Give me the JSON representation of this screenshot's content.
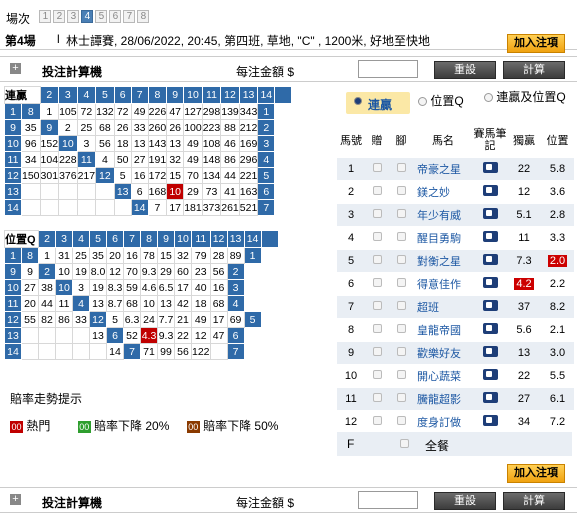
{
  "header": {
    "race_label": "場次",
    "races": [
      "1",
      "2",
      "3",
      "4",
      "5",
      "6",
      "7",
      "8"
    ],
    "active_race": "4"
  },
  "race_info": {
    "race_no": "第4場",
    "sep": "l",
    "details": "林士譚賽, 28/06/2022, 20:45, 第四班, 草地, \"C\" , 1200米, 好地至快地"
  },
  "add_bet_label": "加入注項",
  "calc": {
    "title": "投注計算機",
    "unit_label": "每注金額 $",
    "amount": "",
    "reset": "重設",
    "calculate": "計算"
  },
  "modes": {
    "lianying": "連贏",
    "weizhi": "位置Q",
    "both": "連贏及位置Q",
    "selected": "lianying"
  },
  "quinella": {
    "title": "連贏",
    "cols": [
      "2",
      "3",
      "4",
      "5",
      "6",
      "7",
      "8",
      "9",
      "10",
      "11",
      "12",
      "13",
      "14"
    ],
    "rows": [
      [
        "1",
        "8",
        "1",
        "105",
        "72",
        "132",
        "72",
        "49",
        "226",
        "47",
        "127",
        "298",
        "139",
        "343"
      ],
      [
        "9",
        "35",
        "9",
        "2",
        "25",
        "68",
        "26",
        "33",
        "260",
        "26",
        "100",
        "223",
        "88",
        "212"
      ],
      [
        "10",
        "96",
        "152",
        "10",
        "3",
        "56",
        "18",
        "13",
        "143",
        "13",
        "49",
        "108",
        "46",
        "169"
      ],
      [
        "11",
        "34",
        "104",
        "228",
        "11",
        "4",
        "50",
        "27",
        "191",
        "32",
        "49",
        "148",
        "86",
        "296"
      ],
      [
        "12",
        "150",
        "301",
        "376",
        "217",
        "12",
        "5",
        "16",
        "172",
        "15",
        "70",
        "134",
        "44",
        "221"
      ],
      [
        "13",
        "",
        "",
        "",
        "",
        "",
        "13",
        "6",
        "168",
        "10",
        "29",
        "73",
        "41",
        "163"
      ],
      [
        "14",
        "",
        "",
        "",
        "",
        "",
        "",
        "14",
        "7",
        "17",
        "181",
        "373",
        "261",
        "521"
      ]
    ]
  },
  "place": {
    "title": "位置Q",
    "cols": [
      "2",
      "3",
      "4",
      "5",
      "6",
      "7",
      "8",
      "9",
      "10",
      "11",
      "12",
      "13",
      "14"
    ],
    "rows": [
      [
        "1",
        "8",
        "1",
        "31",
        "25",
        "35",
        "20",
        "16",
        "78",
        "15",
        "32",
        "79",
        "28",
        "89"
      ],
      [
        "9",
        "9",
        "2",
        "10",
        "19",
        "8.0",
        "12",
        "70",
        "9.3",
        "29",
        "60",
        "23",
        "56"
      ],
      [
        "10",
        "27",
        "38",
        "10",
        "3",
        "19",
        "8.3",
        "59",
        "4.6",
        "6.5",
        "17",
        "40",
        "16"
      ],
      [
        "11",
        "20",
        "44",
        "11",
        "4",
        "13",
        "8.7",
        "68",
        "10",
        "13",
        "42",
        "18",
        "68"
      ],
      [
        "12",
        "55",
        "82",
        "86",
        "33",
        "12",
        "5",
        "6.3",
        "24",
        "7.7",
        "21",
        "49",
        "17",
        "69"
      ],
      [
        "13",
        "",
        "",
        "",
        "",
        "13",
        "6",
        "52",
        "4.3",
        "9.3",
        "22",
        "12",
        "47"
      ],
      [
        "14",
        "",
        "",
        "",
        "",
        "",
        "14",
        "7",
        "71",
        "99",
        "56",
        "122",
        ""
      ]
    ]
  },
  "legend": {
    "title": "賠率走勢提示",
    "hot": "熱門",
    "drop20": "賠率下降 20%",
    "drop50": "賠率下降 50%",
    "sq_label": "00"
  },
  "horses_header": {
    "no": "馬號",
    "left": "贈",
    "right": "腳",
    "name": "馬名",
    "jockey": "賽馬筆記",
    "win": "獨贏",
    "place": "位置"
  },
  "horses": [
    {
      "no": "1",
      "name": "帝豪之星",
      "win": "22",
      "place": "5.8"
    },
    {
      "no": "2",
      "name": "鎂之妙",
      "win": "12",
      "place": "3.6"
    },
    {
      "no": "3",
      "name": "年少有威",
      "win": "5.1",
      "place": "2.8"
    },
    {
      "no": "4",
      "name": "醒目勇駒",
      "win": "11",
      "place": "3.3"
    },
    {
      "no": "5",
      "name": "對衡之星",
      "win": "7.3",
      "place": "2.0"
    },
    {
      "no": "6",
      "name": "得意佳作",
      "win": "4.2",
      "place": "2.2"
    },
    {
      "no": "7",
      "name": "超班",
      "win": "37",
      "place": "8.2"
    },
    {
      "no": "8",
      "name": "皇龍帝國",
      "win": "5.6",
      "place": "2.1"
    },
    {
      "no": "9",
      "name": "歡樂好友",
      "win": "13",
      "place": "3.0"
    },
    {
      "no": "10",
      "name": "開心蔬菜",
      "win": "22",
      "place": "5.5"
    },
    {
      "no": "11",
      "name": "騰龍超影",
      "win": "27",
      "place": "6.1"
    },
    {
      "no": "12",
      "name": "度身訂做",
      "win": "34",
      "place": "7.2"
    }
  ],
  "field": {
    "label": "F",
    "all": "全餐"
  },
  "colors": {
    "accent": "#2f6aa8",
    "hot": "#c00000",
    "drop20": "#2f9e2f",
    "drop50": "#8a3a00"
  }
}
